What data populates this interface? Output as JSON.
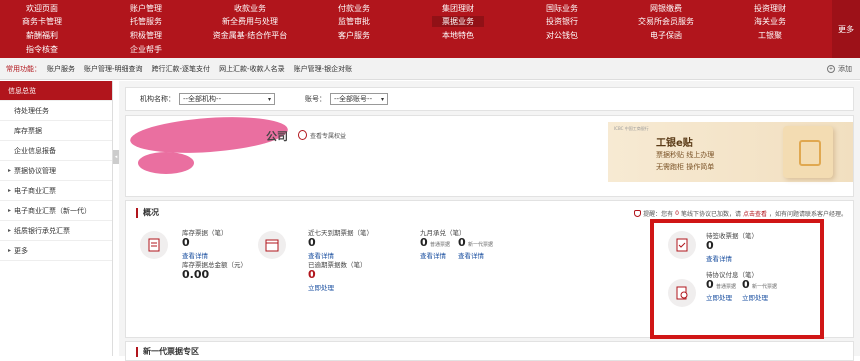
{
  "topnav": {
    "row1": [
      "欢迎页面",
      "账户管理",
      "收款业务",
      "付款业务",
      "集团理财",
      "国际业务",
      "网银缴费",
      "投资理财"
    ],
    "row2": [
      "商务卡管理",
      "托管服务",
      "新全费用与处理",
      "监管审批",
      "票据业务",
      "投资银行",
      "交易所会员服务",
      "海关业务"
    ],
    "row3": [
      "薪酬福利",
      "积极管理",
      "资金属基·结合作平台",
      "客户服务",
      "本地特色",
      "对公钱包",
      "电子保函",
      "工银聚"
    ],
    "row4": [
      "指令核查",
      "企业帮手"
    ],
    "more": "更多"
  },
  "shortcuts": {
    "label": "常用功能：",
    "items": [
      "账户服务",
      "账户管理-明细查询",
      "跨行汇款-逐笔支付",
      "网上汇款-收款人名录",
      "账户管理-银企对账"
    ],
    "add": "添加"
  },
  "sidebar": {
    "items": [
      {
        "label": "信息总览",
        "active": true,
        "arrow": false
      },
      {
        "label": "待处理任务",
        "active": false,
        "arrow": false
      },
      {
        "label": "库存票据",
        "active": false,
        "arrow": false
      },
      {
        "label": "企业信息报备",
        "active": false,
        "arrow": false
      },
      {
        "label": "票据协议管理",
        "active": false,
        "arrow": true
      },
      {
        "label": "电子商业汇票",
        "active": false,
        "arrow": true
      },
      {
        "label": "电子商业汇票（新一代）",
        "active": false,
        "arrow": true
      },
      {
        "label": "纸质银行承兑汇票",
        "active": false,
        "arrow": true
      },
      {
        "label": "更多",
        "active": false,
        "arrow": true
      }
    ]
  },
  "filter": {
    "org_label": "机构名称：",
    "org_value": "--全部机构--",
    "acct_label": "账号：",
    "acct_value": "--全部账号--"
  },
  "company": {
    "name_suffix": "公司",
    "rights_link": "查看专属权益"
  },
  "banner": {
    "logo": "ICBC 中国工商银行",
    "title": "工银e贴",
    "line1": "票据秒贴 线上办理",
    "line2": "无需跑柜 操作简单"
  },
  "overview": {
    "title": "概况",
    "notice_prefix": "提醒：您有",
    "notice_num": "0",
    "notice_mid": "笔线下协议已加数，请",
    "notice_link": "点击查看",
    "notice_suffix": "，如有问题请联系客户经理。",
    "inventory": {
      "count_label": "库存票据（笔）",
      "count": "0",
      "detail_link": "查看详情",
      "amount_label": "库存票据总金额（元）",
      "amount": "0.00"
    },
    "expiring": {
      "label": "近七天到期票据（笔）",
      "count": "0",
      "detail_link": "查看详情",
      "overdue_label": "已逾期票据数（笔）",
      "overdue_count": "0",
      "overdue_link": "立即处理"
    },
    "nine_nine": {
      "label": "九月承兑（笔）",
      "count_a": "0",
      "count_a_label": "普通票据",
      "count_b": "0",
      "count_b_label": "新一代票据",
      "detail_link_a": "查看详情",
      "detail_link_b": "查看详情"
    },
    "pending_receive": {
      "label": "待签收票据（笔）",
      "count": "0",
      "detail_link": "查看详情"
    },
    "pending_sign": {
      "label": "待协议付息（笔）",
      "count_a": "0",
      "count_a_label": "普通票据",
      "count_b": "0",
      "count_b_label": "新一代票据",
      "link_a": "立即处理",
      "link_b": "立即处理"
    }
  },
  "newgen": {
    "title": "新一代票据专区"
  },
  "colors": {
    "brand": "#b1151c",
    "highlight_box": "#d01616",
    "link": "#1a4fa0"
  }
}
